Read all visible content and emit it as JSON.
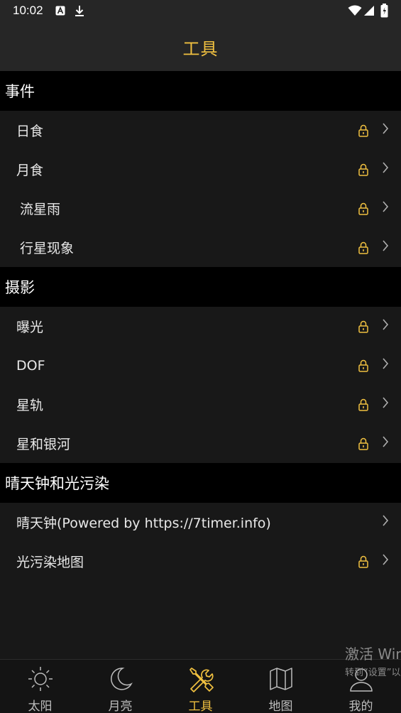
{
  "status_bar": {
    "time": "10:02"
  },
  "header": {
    "title": "工具"
  },
  "sections": [
    {
      "title": "事件",
      "items": [
        {
          "label": "日食",
          "locked": true
        },
        {
          "label": "月食",
          "locked": true
        },
        {
          "label": "流星雨",
          "locked": true
        },
        {
          "label": "行星现象",
          "locked": true
        }
      ]
    },
    {
      "title": "摄影",
      "items": [
        {
          "label": "曝光",
          "locked": true
        },
        {
          "label": "DOF",
          "locked": true
        },
        {
          "label": "星轨",
          "locked": true
        },
        {
          "label": "星和银河",
          "locked": true
        }
      ]
    },
    {
      "title": "晴天钟和光污染",
      "items": [
        {
          "label": "晴天钟(Powered by https://7timer.info)",
          "locked": false
        },
        {
          "label": "光污染地图",
          "locked": true
        }
      ]
    }
  ],
  "tabs": [
    {
      "label": "太阳",
      "icon": "sun-icon",
      "active": false
    },
    {
      "label": "月亮",
      "icon": "moon-icon",
      "active": false
    },
    {
      "label": "工具",
      "icon": "tools-icon",
      "active": true
    },
    {
      "label": "地图",
      "icon": "map-icon",
      "active": false
    },
    {
      "label": "我的",
      "icon": "profile-icon",
      "active": false
    }
  ],
  "watermark": {
    "line1": "激活 Win",
    "line2": "转到“设置”以"
  },
  "colors": {
    "accent": "#f0c040",
    "background": "#181818",
    "section_bg": "#000000",
    "bar_bg": "#262626"
  }
}
